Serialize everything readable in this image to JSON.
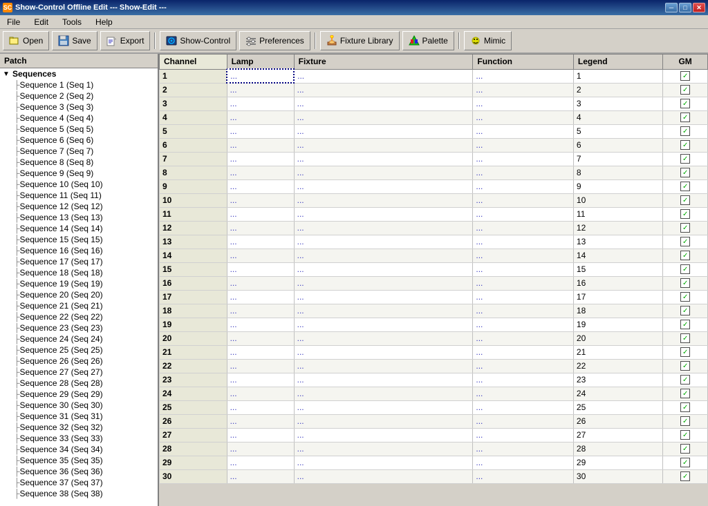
{
  "window": {
    "title": "Show-Control Offline Edit --- Show-Edit ---",
    "icon": "SC"
  },
  "titlebar": {
    "minimize": "─",
    "maximize": "□",
    "close": "✕"
  },
  "menu": {
    "items": [
      "File",
      "Edit",
      "Tools",
      "Help"
    ]
  },
  "toolbar": {
    "buttons": [
      {
        "id": "open",
        "label": "Open",
        "icon": "folder"
      },
      {
        "id": "save",
        "label": "Save",
        "icon": "save"
      },
      {
        "id": "export",
        "label": "Export",
        "icon": "export"
      },
      {
        "id": "show-control",
        "label": "Show-Control",
        "icon": "sc"
      },
      {
        "id": "preferences",
        "label": "Preferences",
        "icon": "pref"
      },
      {
        "id": "fixture-library",
        "label": "Fixture Library",
        "icon": "fixture"
      },
      {
        "id": "palette",
        "label": "Palette",
        "icon": "palette"
      },
      {
        "id": "mimic",
        "label": "Mimic",
        "icon": "mimic"
      }
    ]
  },
  "left_panel": {
    "header": "Patch",
    "tree": {
      "root": "Sequences",
      "items": [
        "Sequence 1 (Seq 1)",
        "Sequence 2 (Seq 2)",
        "Sequence 3 (Seq 3)",
        "Sequence 4 (Seq 4)",
        "Sequence 5 (Seq 5)",
        "Sequence 6 (Seq 6)",
        "Sequence 7 (Seq 7)",
        "Sequence 8 (Seq 8)",
        "Sequence 9 (Seq 9)",
        "Sequence 10 (Seq 10)",
        "Sequence 11 (Seq 11)",
        "Sequence 12 (Seq 12)",
        "Sequence 13 (Seq 13)",
        "Sequence 14 (Seq 14)",
        "Sequence 15 (Seq 15)",
        "Sequence 16 (Seq 16)",
        "Sequence 17 (Seq 17)",
        "Sequence 18 (Seq 18)",
        "Sequence 19 (Seq 19)",
        "Sequence 20 (Seq 20)",
        "Sequence 21 (Seq 21)",
        "Sequence 22 (Seq 22)",
        "Sequence 23 (Seq 23)",
        "Sequence 24 (Seq 24)",
        "Sequence 25 (Seq 25)",
        "Sequence 26 (Seq 26)",
        "Sequence 27 (Seq 27)",
        "Sequence 28 (Seq 28)",
        "Sequence 29 (Seq 29)",
        "Sequence 30 (Seq 30)",
        "Sequence 31 (Seq 31)",
        "Sequence 32 (Seq 32)",
        "Sequence 33 (Seq 33)",
        "Sequence 34 (Seq 34)",
        "Sequence 35 (Seq 35)",
        "Sequence 36 (Seq 36)",
        "Sequence 37 (Seq 37)",
        "Sequence 38 (Seq 38)"
      ]
    }
  },
  "table": {
    "headers": [
      "Channel",
      "Lamp",
      "Fixture",
      "Function",
      "Legend",
      "GM"
    ],
    "rows_count": 30,
    "ellipsis": "...",
    "checkbox_char": "✓"
  },
  "colors": {
    "header_bg": "#0a246a",
    "accent_blue": "#3a6ea5",
    "checkbox_green": "#00aa00",
    "ellipsis_blue": "#4040c0"
  }
}
